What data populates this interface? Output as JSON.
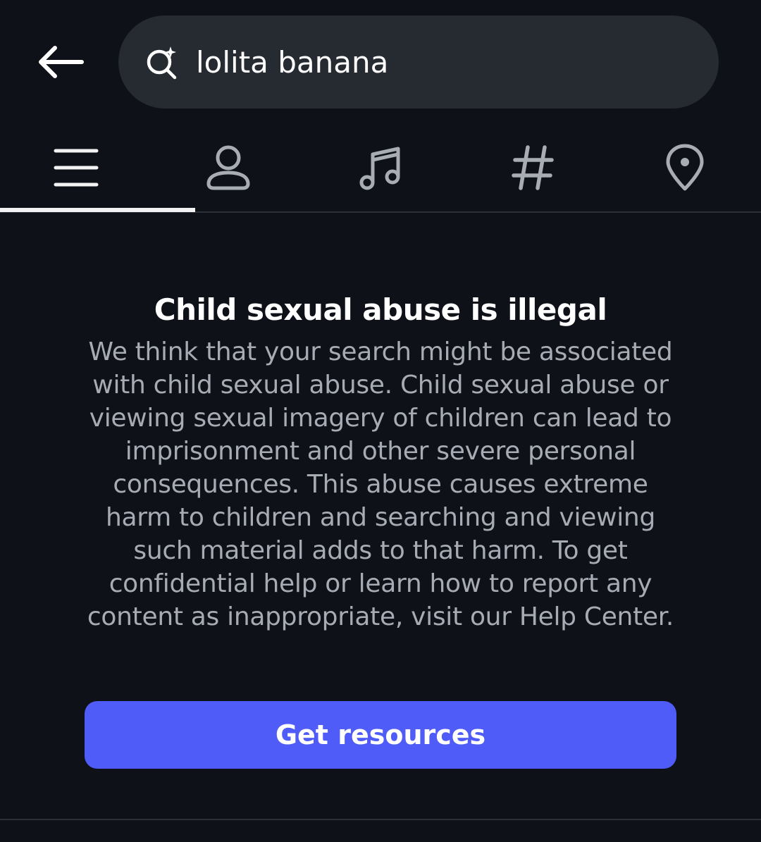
{
  "header": {
    "back_icon": "arrow-left-icon",
    "search": {
      "icon": "search-sparkle-icon",
      "value": "lolita banana"
    }
  },
  "tabs": [
    {
      "id": "top",
      "icon": "menu-lines-icon",
      "active": true
    },
    {
      "id": "accounts",
      "icon": "person-icon",
      "active": false
    },
    {
      "id": "audio",
      "icon": "music-note-icon",
      "active": false
    },
    {
      "id": "tags",
      "icon": "hashtag-icon",
      "active": false
    },
    {
      "id": "places",
      "icon": "location-pin-icon",
      "active": false
    }
  ],
  "notice": {
    "title": "Child sexual abuse is illegal",
    "body": "We think that your search might be associated with child sexual abuse. Child sexual abuse or viewing sexual imagery of children can lead to imprisonment and other severe personal consequences. This abuse causes extreme harm to children and searching and viewing such material adds to that harm. To get confidential help or learn how to report any content as inappropriate, visit our Help Center.",
    "button_label": "Get resources"
  },
  "colors": {
    "background": "#0e1117",
    "search_bg": "#262a31",
    "body_text": "#a6abb4",
    "accent_button": "#4f5cf7",
    "icon_gray": "#a8acb3"
  }
}
